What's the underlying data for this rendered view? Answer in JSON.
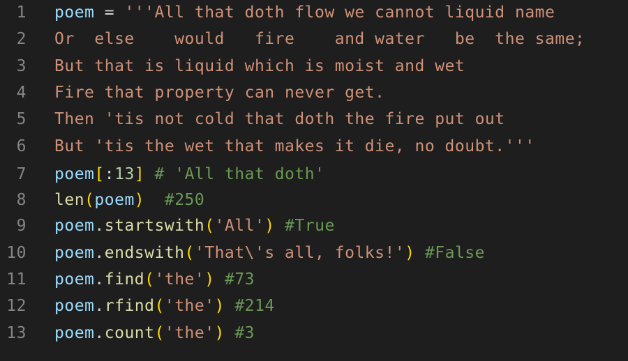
{
  "editor": {
    "colors": {
      "background": "#1e1e1e",
      "line_number": "#858585",
      "variable": "#9cdcfe",
      "function": "#dcdcaa",
      "string": "#ce9178",
      "comment": "#6a9955",
      "number": "#b5cea8",
      "bracket": "#ffd700"
    },
    "lines": [
      {
        "number": "1",
        "tokens": [
          {
            "text": "poem",
            "kind": "var"
          },
          {
            "text": " = ",
            "kind": "op"
          },
          {
            "text": "'''All that doth flow we cannot liquid name",
            "kind": "str"
          }
        ]
      },
      {
        "number": "2",
        "tokens": [
          {
            "text": "Or  else    would   fire    and water   be  the same;",
            "kind": "str"
          }
        ]
      },
      {
        "number": "3",
        "tokens": [
          {
            "text": "But that is liquid which is moist and wet",
            "kind": "str"
          }
        ]
      },
      {
        "number": "4",
        "tokens": [
          {
            "text": "Fire that property can never get.",
            "kind": "str"
          }
        ]
      },
      {
        "number": "5",
        "tokens": [
          {
            "text": "Then 'tis not cold that doth the fire put out",
            "kind": "str"
          }
        ]
      },
      {
        "number": "6",
        "tokens": [
          {
            "text": "But 'tis the wet that makes it die, no doubt.'''",
            "kind": "str"
          }
        ]
      },
      {
        "number": "7",
        "tokens": [
          {
            "text": "poem",
            "kind": "var"
          },
          {
            "text": "[",
            "kind": "br"
          },
          {
            "text": ":",
            "kind": "op"
          },
          {
            "text": "13",
            "kind": "num"
          },
          {
            "text": "]",
            "kind": "br"
          },
          {
            "text": " ",
            "kind": "op"
          },
          {
            "text": "# 'All that doth'",
            "kind": "com"
          }
        ]
      },
      {
        "number": "8",
        "tokens": [
          {
            "text": "len",
            "kind": "fn"
          },
          {
            "text": "(",
            "kind": "br"
          },
          {
            "text": "poem",
            "kind": "var"
          },
          {
            "text": ")",
            "kind": "br"
          },
          {
            "text": "  ",
            "kind": "op"
          },
          {
            "text": "#250",
            "kind": "com"
          }
        ]
      },
      {
        "number": "9",
        "tokens": [
          {
            "text": "poem",
            "kind": "var"
          },
          {
            "text": ".",
            "kind": "op"
          },
          {
            "text": "startswith",
            "kind": "fn"
          },
          {
            "text": "(",
            "kind": "br"
          },
          {
            "text": "'All'",
            "kind": "str"
          },
          {
            "text": ")",
            "kind": "br"
          },
          {
            "text": " ",
            "kind": "op"
          },
          {
            "text": "#True",
            "kind": "com"
          }
        ]
      },
      {
        "number": "10",
        "tokens": [
          {
            "text": "poem",
            "kind": "var"
          },
          {
            "text": ".",
            "kind": "op"
          },
          {
            "text": "endswith",
            "kind": "fn"
          },
          {
            "text": "(",
            "kind": "br"
          },
          {
            "text": "'That\\'s all, folks!'",
            "kind": "str"
          },
          {
            "text": ")",
            "kind": "br"
          },
          {
            "text": " ",
            "kind": "op"
          },
          {
            "text": "#False",
            "kind": "com"
          }
        ]
      },
      {
        "number": "11",
        "tokens": [
          {
            "text": "poem",
            "kind": "var"
          },
          {
            "text": ".",
            "kind": "op"
          },
          {
            "text": "find",
            "kind": "fn"
          },
          {
            "text": "(",
            "kind": "br"
          },
          {
            "text": "'the'",
            "kind": "str"
          },
          {
            "text": ")",
            "kind": "br"
          },
          {
            "text": " ",
            "kind": "op"
          },
          {
            "text": "#73",
            "kind": "com"
          }
        ]
      },
      {
        "number": "12",
        "tokens": [
          {
            "text": "poem",
            "kind": "var"
          },
          {
            "text": ".",
            "kind": "op"
          },
          {
            "text": "rfind",
            "kind": "fn"
          },
          {
            "text": "(",
            "kind": "br"
          },
          {
            "text": "'the'",
            "kind": "str"
          },
          {
            "text": ")",
            "kind": "br"
          },
          {
            "text": " ",
            "kind": "op"
          },
          {
            "text": "#214",
            "kind": "com"
          }
        ]
      },
      {
        "number": "13",
        "tokens": [
          {
            "text": "poem",
            "kind": "var"
          },
          {
            "text": ".",
            "kind": "op"
          },
          {
            "text": "count",
            "kind": "fn"
          },
          {
            "text": "(",
            "kind": "br"
          },
          {
            "text": "'the'",
            "kind": "str"
          },
          {
            "text": ")",
            "kind": "br"
          },
          {
            "text": " ",
            "kind": "op"
          },
          {
            "text": "#3",
            "kind": "com"
          }
        ]
      }
    ]
  }
}
